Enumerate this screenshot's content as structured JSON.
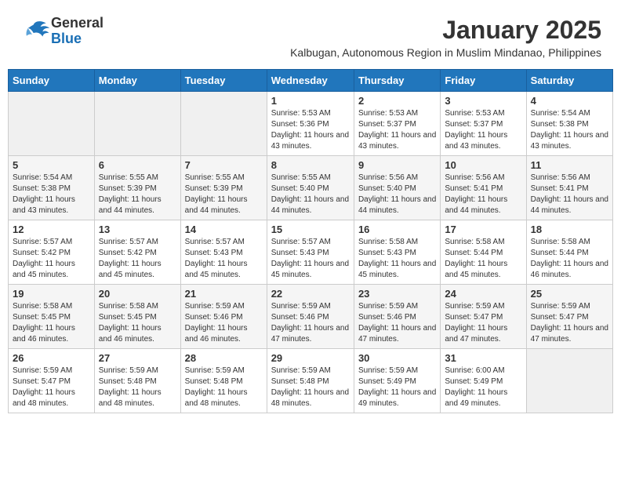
{
  "header": {
    "logo_general": "General",
    "logo_blue": "Blue",
    "month_title": "January 2025",
    "location": "Kalbugan, Autonomous Region in Muslim Mindanao, Philippines"
  },
  "days_of_week": [
    "Sunday",
    "Monday",
    "Tuesday",
    "Wednesday",
    "Thursday",
    "Friday",
    "Saturday"
  ],
  "weeks": [
    {
      "days": [
        {
          "number": "",
          "sunrise": "",
          "sunset": "",
          "daylight": ""
        },
        {
          "number": "",
          "sunrise": "",
          "sunset": "",
          "daylight": ""
        },
        {
          "number": "",
          "sunrise": "",
          "sunset": "",
          "daylight": ""
        },
        {
          "number": "1",
          "sunrise": "Sunrise: 5:53 AM",
          "sunset": "Sunset: 5:36 PM",
          "daylight": "Daylight: 11 hours and 43 minutes."
        },
        {
          "number": "2",
          "sunrise": "Sunrise: 5:53 AM",
          "sunset": "Sunset: 5:37 PM",
          "daylight": "Daylight: 11 hours and 43 minutes."
        },
        {
          "number": "3",
          "sunrise": "Sunrise: 5:53 AM",
          "sunset": "Sunset: 5:37 PM",
          "daylight": "Daylight: 11 hours and 43 minutes."
        },
        {
          "number": "4",
          "sunrise": "Sunrise: 5:54 AM",
          "sunset": "Sunset: 5:38 PM",
          "daylight": "Daylight: 11 hours and 43 minutes."
        }
      ]
    },
    {
      "days": [
        {
          "number": "5",
          "sunrise": "Sunrise: 5:54 AM",
          "sunset": "Sunset: 5:38 PM",
          "daylight": "Daylight: 11 hours and 43 minutes."
        },
        {
          "number": "6",
          "sunrise": "Sunrise: 5:55 AM",
          "sunset": "Sunset: 5:39 PM",
          "daylight": "Daylight: 11 hours and 44 minutes."
        },
        {
          "number": "7",
          "sunrise": "Sunrise: 5:55 AM",
          "sunset": "Sunset: 5:39 PM",
          "daylight": "Daylight: 11 hours and 44 minutes."
        },
        {
          "number": "8",
          "sunrise": "Sunrise: 5:55 AM",
          "sunset": "Sunset: 5:40 PM",
          "daylight": "Daylight: 11 hours and 44 minutes."
        },
        {
          "number": "9",
          "sunrise": "Sunrise: 5:56 AM",
          "sunset": "Sunset: 5:40 PM",
          "daylight": "Daylight: 11 hours and 44 minutes."
        },
        {
          "number": "10",
          "sunrise": "Sunrise: 5:56 AM",
          "sunset": "Sunset: 5:41 PM",
          "daylight": "Daylight: 11 hours and 44 minutes."
        },
        {
          "number": "11",
          "sunrise": "Sunrise: 5:56 AM",
          "sunset": "Sunset: 5:41 PM",
          "daylight": "Daylight: 11 hours and 44 minutes."
        }
      ]
    },
    {
      "days": [
        {
          "number": "12",
          "sunrise": "Sunrise: 5:57 AM",
          "sunset": "Sunset: 5:42 PM",
          "daylight": "Daylight: 11 hours and 45 minutes."
        },
        {
          "number": "13",
          "sunrise": "Sunrise: 5:57 AM",
          "sunset": "Sunset: 5:42 PM",
          "daylight": "Daylight: 11 hours and 45 minutes."
        },
        {
          "number": "14",
          "sunrise": "Sunrise: 5:57 AM",
          "sunset": "Sunset: 5:43 PM",
          "daylight": "Daylight: 11 hours and 45 minutes."
        },
        {
          "number": "15",
          "sunrise": "Sunrise: 5:57 AM",
          "sunset": "Sunset: 5:43 PM",
          "daylight": "Daylight: 11 hours and 45 minutes."
        },
        {
          "number": "16",
          "sunrise": "Sunrise: 5:58 AM",
          "sunset": "Sunset: 5:43 PM",
          "daylight": "Daylight: 11 hours and 45 minutes."
        },
        {
          "number": "17",
          "sunrise": "Sunrise: 5:58 AM",
          "sunset": "Sunset: 5:44 PM",
          "daylight": "Daylight: 11 hours and 45 minutes."
        },
        {
          "number": "18",
          "sunrise": "Sunrise: 5:58 AM",
          "sunset": "Sunset: 5:44 PM",
          "daylight": "Daylight: 11 hours and 46 minutes."
        }
      ]
    },
    {
      "days": [
        {
          "number": "19",
          "sunrise": "Sunrise: 5:58 AM",
          "sunset": "Sunset: 5:45 PM",
          "daylight": "Daylight: 11 hours and 46 minutes."
        },
        {
          "number": "20",
          "sunrise": "Sunrise: 5:58 AM",
          "sunset": "Sunset: 5:45 PM",
          "daylight": "Daylight: 11 hours and 46 minutes."
        },
        {
          "number": "21",
          "sunrise": "Sunrise: 5:59 AM",
          "sunset": "Sunset: 5:46 PM",
          "daylight": "Daylight: 11 hours and 46 minutes."
        },
        {
          "number": "22",
          "sunrise": "Sunrise: 5:59 AM",
          "sunset": "Sunset: 5:46 PM",
          "daylight": "Daylight: 11 hours and 47 minutes."
        },
        {
          "number": "23",
          "sunrise": "Sunrise: 5:59 AM",
          "sunset": "Sunset: 5:46 PM",
          "daylight": "Daylight: 11 hours and 47 minutes."
        },
        {
          "number": "24",
          "sunrise": "Sunrise: 5:59 AM",
          "sunset": "Sunset: 5:47 PM",
          "daylight": "Daylight: 11 hours and 47 minutes."
        },
        {
          "number": "25",
          "sunrise": "Sunrise: 5:59 AM",
          "sunset": "Sunset: 5:47 PM",
          "daylight": "Daylight: 11 hours and 47 minutes."
        }
      ]
    },
    {
      "days": [
        {
          "number": "26",
          "sunrise": "Sunrise: 5:59 AM",
          "sunset": "Sunset: 5:47 PM",
          "daylight": "Daylight: 11 hours and 48 minutes."
        },
        {
          "number": "27",
          "sunrise": "Sunrise: 5:59 AM",
          "sunset": "Sunset: 5:48 PM",
          "daylight": "Daylight: 11 hours and 48 minutes."
        },
        {
          "number": "28",
          "sunrise": "Sunrise: 5:59 AM",
          "sunset": "Sunset: 5:48 PM",
          "daylight": "Daylight: 11 hours and 48 minutes."
        },
        {
          "number": "29",
          "sunrise": "Sunrise: 5:59 AM",
          "sunset": "Sunset: 5:48 PM",
          "daylight": "Daylight: 11 hours and 48 minutes."
        },
        {
          "number": "30",
          "sunrise": "Sunrise: 5:59 AM",
          "sunset": "Sunset: 5:49 PM",
          "daylight": "Daylight: 11 hours and 49 minutes."
        },
        {
          "number": "31",
          "sunrise": "Sunrise: 6:00 AM",
          "sunset": "Sunset: 5:49 PM",
          "daylight": "Daylight: 11 hours and 49 minutes."
        },
        {
          "number": "",
          "sunrise": "",
          "sunset": "",
          "daylight": ""
        }
      ]
    }
  ]
}
